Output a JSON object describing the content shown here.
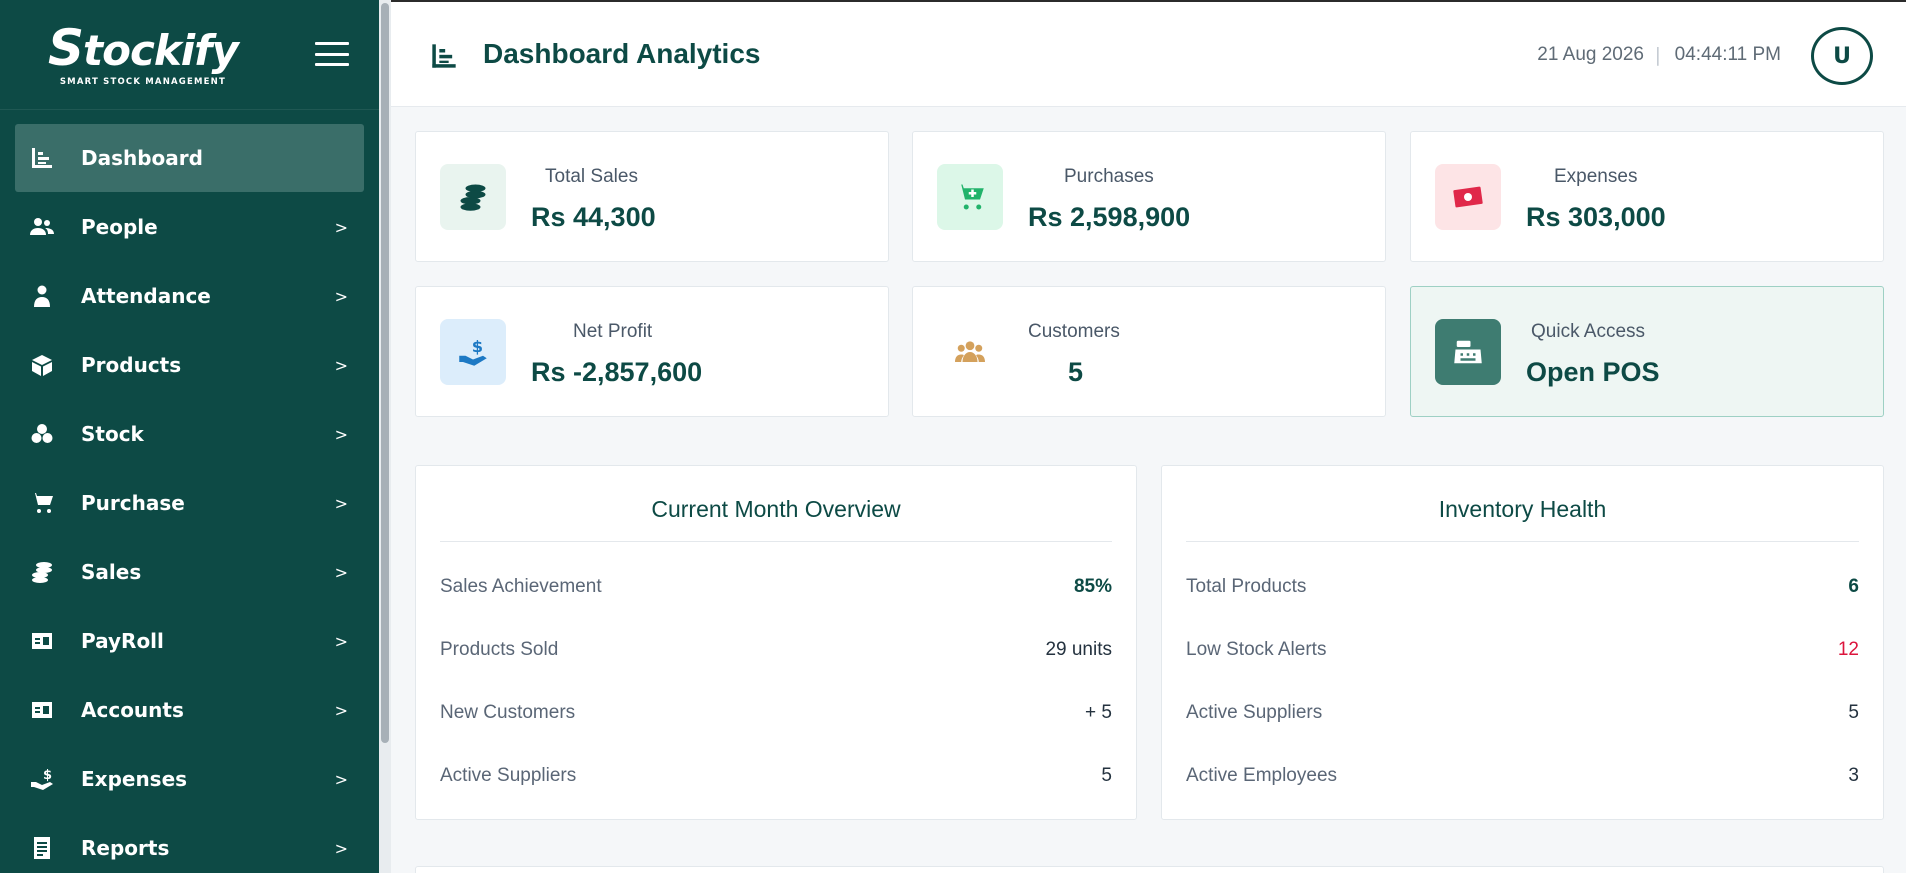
{
  "brand": {
    "name_s": "S",
    "name_rest": "tockify",
    "tagline": "SMART STOCK MANAGEMENT"
  },
  "nav": [
    {
      "label": "Dashboard",
      "icon": "dashboard-icon",
      "active": true,
      "chevron": ""
    },
    {
      "label": "People",
      "icon": "people-icon",
      "chevron": ">"
    },
    {
      "label": "Attendance",
      "icon": "attendance-icon",
      "chevron": ">"
    },
    {
      "label": "Products",
      "icon": "products-icon",
      "chevron": ">"
    },
    {
      "label": "Stock",
      "icon": "stock-icon",
      "chevron": ">"
    },
    {
      "label": "Purchase",
      "icon": "cart-icon",
      "chevron": ">"
    },
    {
      "label": "Sales",
      "icon": "coins-icon",
      "chevron": ">"
    },
    {
      "label": "PayRoll",
      "icon": "payroll-icon",
      "chevron": ">"
    },
    {
      "label": "Accounts",
      "icon": "accounts-icon",
      "chevron": ">"
    },
    {
      "label": "Expenses",
      "icon": "expenses-icon",
      "chevron": ">"
    },
    {
      "label": "Reports",
      "icon": "reports-icon",
      "chevron": ">"
    }
  ],
  "header": {
    "title": "Dashboard Analytics",
    "date": "21 Aug 2026",
    "separator": "|",
    "time": "04:44:11 PM",
    "avatar": "U"
  },
  "stats": {
    "total_sales": {
      "label": "Total Sales",
      "value": "Rs 44,300"
    },
    "purchases": {
      "label": "Purchases",
      "value": "Rs 2,598,900"
    },
    "expenses": {
      "label": "Expenses",
      "value": "Rs 303,000"
    },
    "net_profit": {
      "label": "Net Profit",
      "value": "Rs -2,857,600"
    },
    "customers": {
      "label": "Customers",
      "value": "5"
    },
    "quick_access": {
      "label": "Quick Access",
      "value": "Open POS"
    }
  },
  "overview": {
    "title": "Current Month Overview",
    "rows": [
      {
        "label": "Sales Achievement",
        "value": "85%"
      },
      {
        "label": "Products Sold",
        "value": "29 units"
      },
      {
        "label": "New Customers",
        "value": "+ 5"
      },
      {
        "label": "Active Suppliers",
        "value": "5"
      }
    ]
  },
  "inventory": {
    "title": "Inventory Health",
    "rows": [
      {
        "label": "Total Products",
        "value": "6"
      },
      {
        "label": "Low Stock Alerts",
        "value": "12"
      },
      {
        "label": "Active Suppliers",
        "value": "5"
      },
      {
        "label": "Active Employees",
        "value": "3"
      }
    ]
  },
  "colors": {
    "sidebar": "#0d4a45",
    "accent": "#0d4a45",
    "alert": "#dc143c",
    "active_nav": "#3a6e69"
  }
}
